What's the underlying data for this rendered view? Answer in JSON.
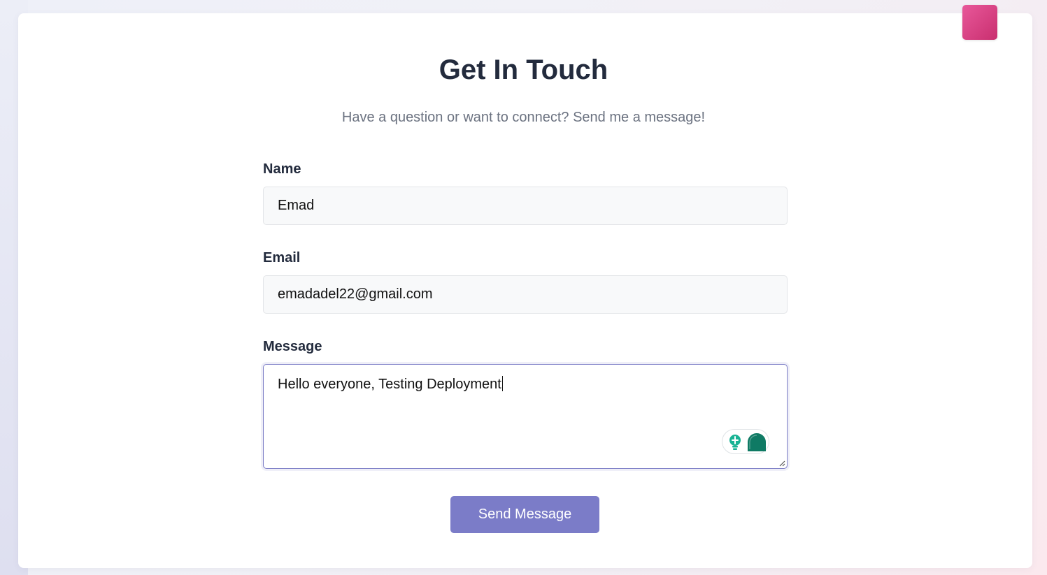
{
  "page": {
    "title": "Get In Touch",
    "subtitle": "Have a question or want to connect? Send me a message!"
  },
  "form": {
    "name": {
      "label": "Name",
      "value": "Emad"
    },
    "email": {
      "label": "Email",
      "value": "emadadel22@gmail.com"
    },
    "message": {
      "label": "Message",
      "value": "Hello everyone, Testing Deployment"
    },
    "submit_label": "Send Message"
  },
  "icons": {
    "corner": "pink-square-icon",
    "assist_bulb": "lightbulb-icon",
    "assist_logo": "grammarly-icon",
    "resize": "resize-handle-icon"
  },
  "colors": {
    "title": "#232b3d",
    "subtitle": "#6b7280",
    "button": "#7b7cc8",
    "accent_pink": "#e8589a",
    "focus_border": "#7b7cc6",
    "assist_green": "#0f7a64"
  }
}
